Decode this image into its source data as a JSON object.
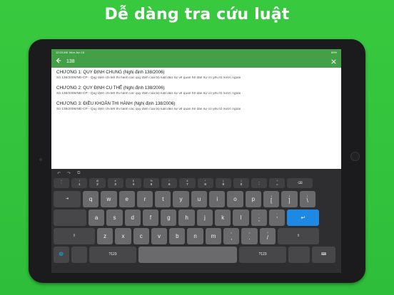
{
  "headline": "Dễ dàng tra cứu luật",
  "status_bar": {
    "time": "12:15 AM",
    "date": "Mon Jun 15",
    "battery": "89%"
  },
  "search": {
    "query": "138",
    "back_icon": "arrow-left-icon",
    "close_icon": "close-icon"
  },
  "results": [
    {
      "title": "CHƯƠNG 1: QUY ĐỊNH CHUNG (Nghị định 138/2006)",
      "desc": "Số 138/2006/NĐ-CP - Quy định chi tiết thi hành các quy định của bộ luật dân sự về quan hệ dân sự có yếu tố nước ngoài"
    },
    {
      "title": "CHƯƠNG 2: QUY ĐỊNH CỤ THỂ (Nghị định 138/2006)",
      "desc": "Số 138/2006/NĐ-CP - Quy định chi tiết thi hành các quy định của bộ luật dân sự về quan hệ dân sự có yếu tố nước ngoài"
    },
    {
      "title": "CHƯƠNG 3: ĐIỀU KHOẢN THI HÀNH (Nghị định 138/2006)",
      "desc": "Số 138/2006/NĐ-CP - Quy định chi tiết thi hành các quy định của bộ luật dân sự về quan hệ dân sự có yếu tố nước ngoài"
    }
  ],
  "keyboard": {
    "toolbar": [
      "↶",
      "↷",
      "⧉"
    ],
    "row_num": [
      {
        "alt": "~",
        "main": "`"
      },
      {
        "alt": "!",
        "main": "1"
      },
      {
        "alt": "@",
        "main": "2"
      },
      {
        "alt": "#",
        "main": "3"
      },
      {
        "alt": "$",
        "main": "4"
      },
      {
        "alt": "%",
        "main": "5"
      },
      {
        "alt": "^",
        "main": "6"
      },
      {
        "alt": "&",
        "main": "7"
      },
      {
        "alt": "*",
        "main": "8"
      },
      {
        "alt": "(",
        "main": "9"
      },
      {
        "alt": ")",
        "main": "0"
      },
      {
        "alt": "_",
        "main": "-"
      },
      {
        "alt": "+",
        "main": "="
      }
    ],
    "row1": [
      "q",
      "w",
      "e",
      "r",
      "t",
      "y",
      "u",
      "i",
      "o",
      "p"
    ],
    "row1_extra": [
      {
        "alt": "{",
        "main": "["
      },
      {
        "alt": "}",
        "main": "]"
      },
      {
        "alt": "|",
        "main": "\\"
      }
    ],
    "row2": [
      "a",
      "s",
      "d",
      "f",
      "g",
      "h",
      "j",
      "k",
      "l"
    ],
    "row2_extra": [
      {
        "alt": ":",
        "main": ";"
      },
      {
        "alt": "\"",
        "main": "'"
      }
    ],
    "row3": [
      "z",
      "x",
      "c",
      "v",
      "b",
      "n",
      "m"
    ],
    "row3_extra": [
      {
        "alt": "<",
        "main": ","
      },
      {
        "alt": ">",
        "main": "."
      },
      {
        "alt": "?",
        "main": "/"
      }
    ],
    "tab_label": "⇥",
    "delete_label": "⌫",
    "shift_label": "⇧",
    "return_label": "↵",
    "globe_label": "🌐",
    "num_label": "?123",
    "dismiss_label": "⌨"
  }
}
